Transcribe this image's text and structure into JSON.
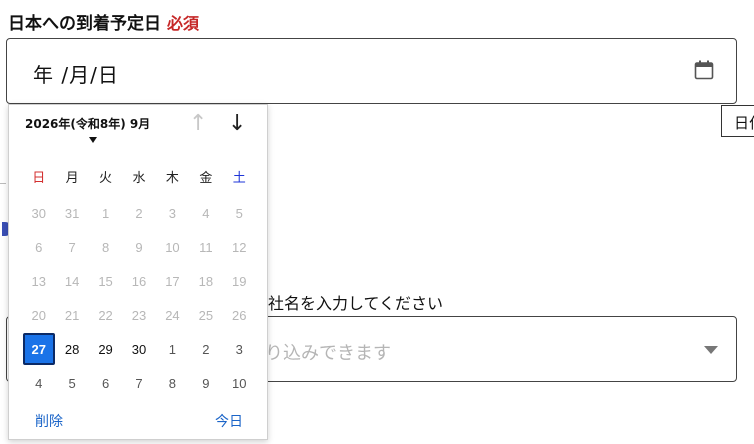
{
  "field": {
    "label": "日本への到着予定日",
    "required": "必須",
    "value": "年 /月/日",
    "calendar_icon": "calendar-icon"
  },
  "tooltip": {
    "text": "日付"
  },
  "background_field": {
    "label": "社名を入力してください",
    "placeholder": "り込みできます"
  },
  "calendar": {
    "title": "2026年(令和8年) 9月",
    "nav_prev": "↑",
    "nav_next": "↓",
    "weekdays": [
      "日",
      "月",
      "火",
      "水",
      "木",
      "金",
      "土"
    ],
    "rows": [
      [
        {
          "d": "30",
          "s": "muted"
        },
        {
          "d": "31",
          "s": "muted"
        },
        {
          "d": "1",
          "s": "muted"
        },
        {
          "d": "2",
          "s": "muted"
        },
        {
          "d": "3",
          "s": "muted"
        },
        {
          "d": "4",
          "s": "muted"
        },
        {
          "d": "5",
          "s": "muted"
        }
      ],
      [
        {
          "d": "6",
          "s": "muted"
        },
        {
          "d": "7",
          "s": "muted"
        },
        {
          "d": "8",
          "s": "muted"
        },
        {
          "d": "9",
          "s": "muted"
        },
        {
          "d": "10",
          "s": "muted"
        },
        {
          "d": "11",
          "s": "muted"
        },
        {
          "d": "12",
          "s": "muted"
        }
      ],
      [
        {
          "d": "13",
          "s": "muted"
        },
        {
          "d": "14",
          "s": "muted"
        },
        {
          "d": "15",
          "s": "muted"
        },
        {
          "d": "16",
          "s": "muted"
        },
        {
          "d": "17",
          "s": "muted"
        },
        {
          "d": "18",
          "s": "muted"
        },
        {
          "d": "19",
          "s": "muted"
        }
      ],
      [
        {
          "d": "20",
          "s": "muted"
        },
        {
          "d": "21",
          "s": "muted"
        },
        {
          "d": "22",
          "s": "muted"
        },
        {
          "d": "23",
          "s": "muted"
        },
        {
          "d": "24",
          "s": "muted"
        },
        {
          "d": "25",
          "s": "muted"
        },
        {
          "d": "26",
          "s": "muted"
        }
      ],
      [
        {
          "d": "27",
          "s": "selected"
        },
        {
          "d": "28",
          "s": "norm"
        },
        {
          "d": "29",
          "s": "norm"
        },
        {
          "d": "30",
          "s": "norm"
        },
        {
          "d": "1",
          "s": "next"
        },
        {
          "d": "2",
          "s": "next"
        },
        {
          "d": "3",
          "s": "next"
        }
      ],
      [
        {
          "d": "4",
          "s": "next"
        },
        {
          "d": "5",
          "s": "next"
        },
        {
          "d": "6",
          "s": "next"
        },
        {
          "d": "7",
          "s": "next"
        },
        {
          "d": "8",
          "s": "next"
        },
        {
          "d": "9",
          "s": "next"
        },
        {
          "d": "10",
          "s": "next"
        }
      ]
    ],
    "clear_label": "削除",
    "today_label": "今日"
  },
  "colors": {
    "required": "#c62828",
    "selected_day": "#1a73e8",
    "sunday": "#d32f2f",
    "saturday": "#1e35d8",
    "link": "#1a64c8"
  }
}
